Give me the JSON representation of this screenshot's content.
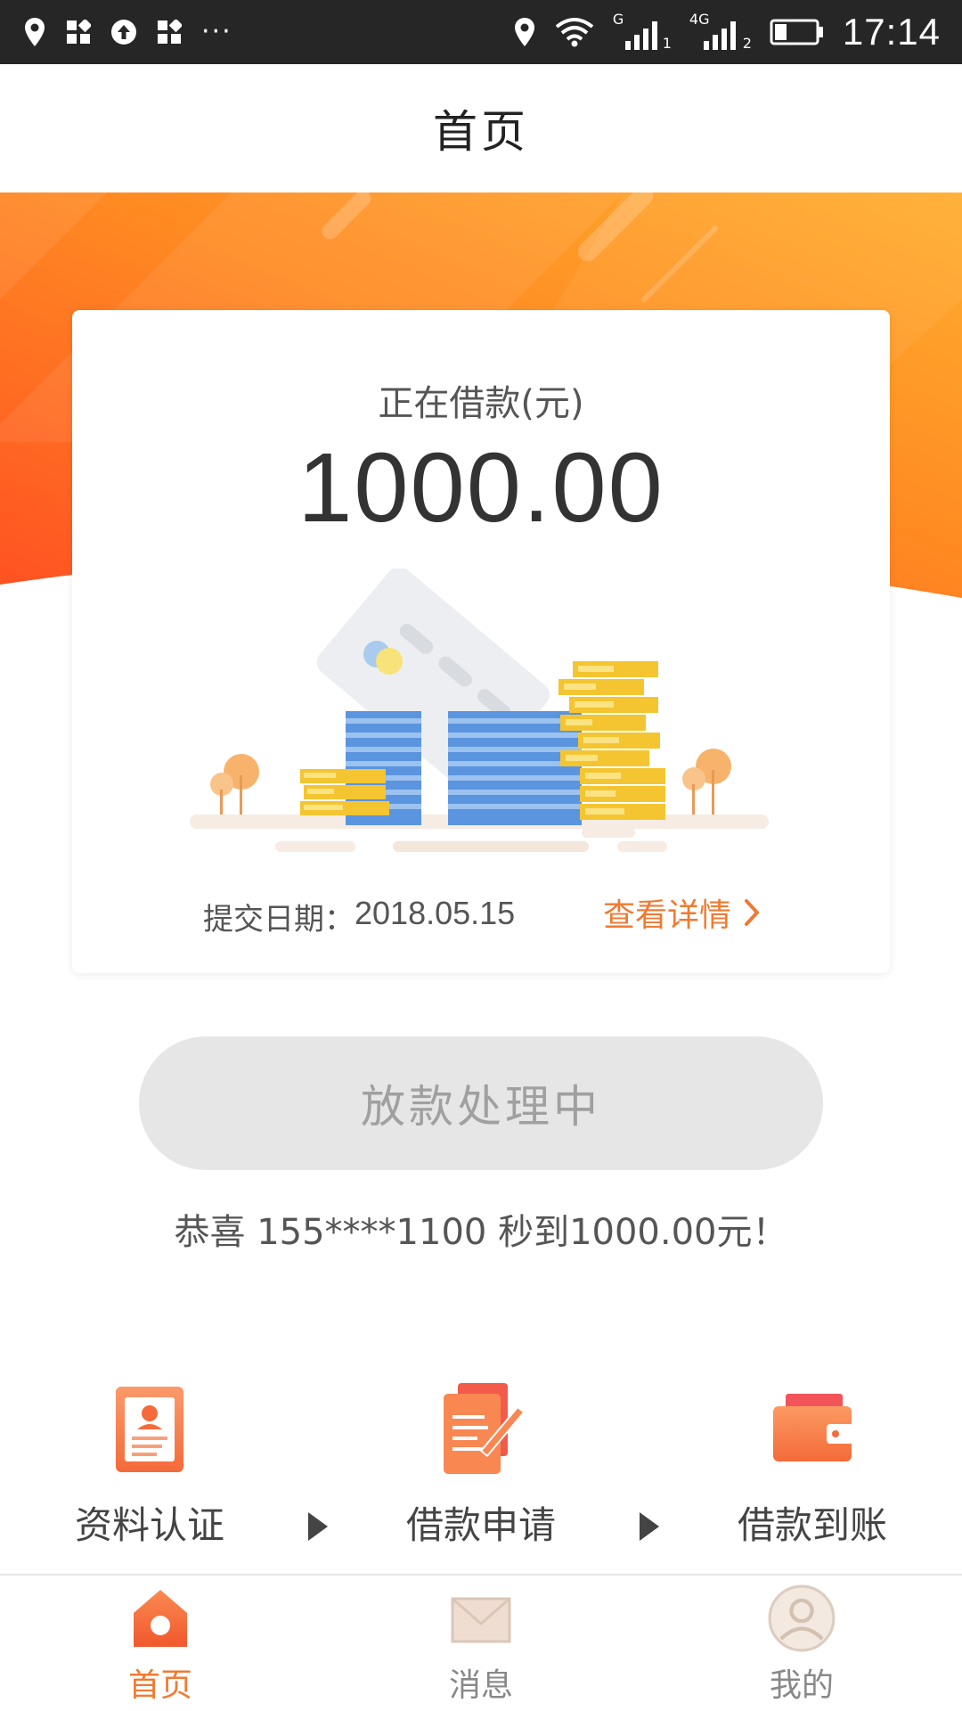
{
  "status_bar": {
    "time": "17:14",
    "left_icons": [
      "location-icon",
      "app-grid-icon",
      "upload-icon",
      "app-grid-icon",
      "more-dots-icon"
    ],
    "right_icons": [
      "location-icon",
      "wifi-icon",
      "signal-g-icon",
      "signal-4g-icon",
      "battery-icon"
    ],
    "dots": "···",
    "sim1_label": "1",
    "sim2_label": "2",
    "net1_label": "G",
    "net2_label": "4G",
    "battery_level": 0.3
  },
  "header": {
    "title": "首页"
  },
  "loan_card": {
    "label": "正在借款(元)",
    "amount": "1000.00",
    "date_label": "提交日期：",
    "date_value": "2018.05.15",
    "detail_link": "查看详情"
  },
  "process_button": {
    "label": "放款处理中"
  },
  "congrats_text": "恭喜 155****1100 秒到1000.00元！",
  "steps": [
    {
      "label": "资料认证",
      "icon": "id-verify-icon"
    },
    {
      "label": "借款申请",
      "icon": "loan-apply-icon"
    },
    {
      "label": "借款到账",
      "icon": "wallet-icon"
    }
  ],
  "tab_bar": {
    "active": 0,
    "tabs": [
      {
        "label": "首页",
        "icon": "home-icon"
      },
      {
        "label": "消息",
        "icon": "mail-icon"
      },
      {
        "label": "我的",
        "icon": "avatar-icon"
      }
    ]
  },
  "colors": {
    "accent": "#f07a32",
    "banner_start": "#ff5a1f",
    "banner_end": "#ffab2e",
    "button_bg": "#e6e6e6",
    "button_text": "#a0a0a0"
  }
}
